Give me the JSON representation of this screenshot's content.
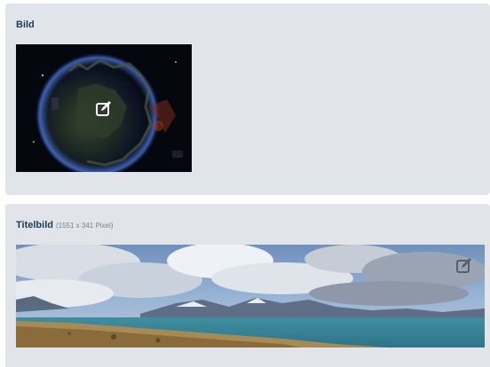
{
  "sections": {
    "bild": {
      "title": "Bild",
      "edit_icon": "pencil-square-icon"
    },
    "titelbild": {
      "title": "Titelbild",
      "dimensions": "(1551 x 341 Pixel)",
      "edit_icon": "pencil-square-icon"
    }
  },
  "colors": {
    "panel_background": "#e1e4e9",
    "title_text": "#1f3b57",
    "dimension_text": "#7a818a"
  }
}
